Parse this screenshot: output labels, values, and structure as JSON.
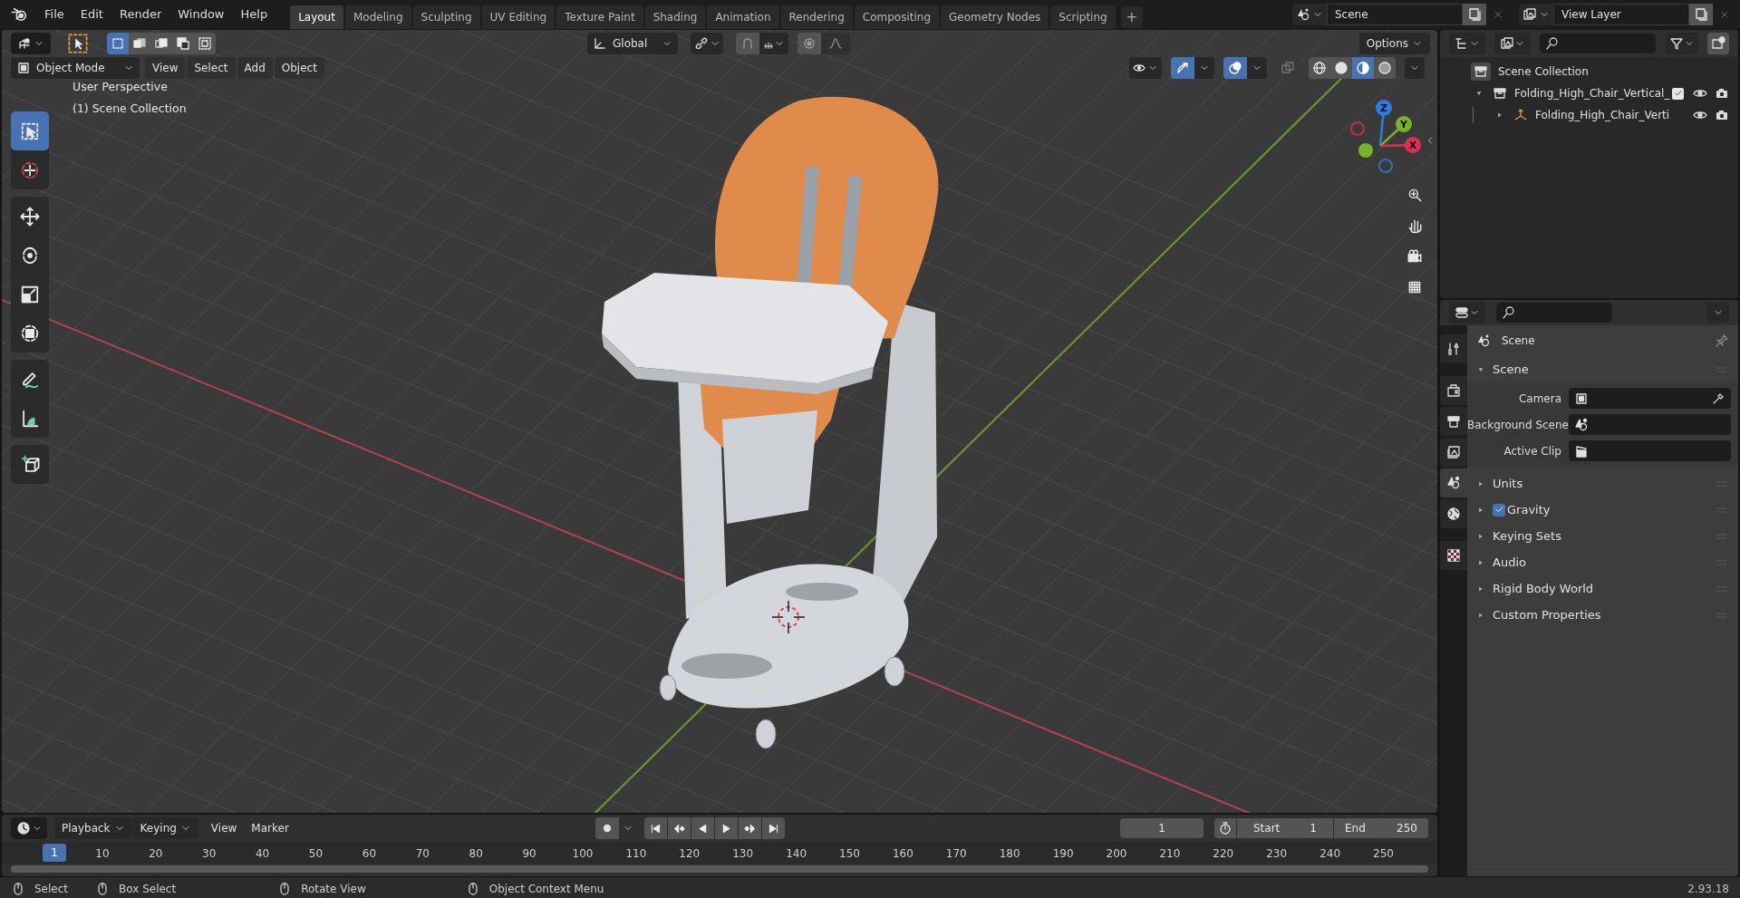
{
  "top_bar": {
    "menus": [
      "File",
      "Edit",
      "Render",
      "Window",
      "Help"
    ],
    "workspace_tabs": [
      {
        "label": "Layout",
        "selected": true
      },
      {
        "label": "Modeling",
        "selected": false
      },
      {
        "label": "Sculpting",
        "selected": false
      },
      {
        "label": "UV Editing",
        "selected": false
      },
      {
        "label": "Texture Paint",
        "selected": false
      },
      {
        "label": "Shading",
        "selected": false
      },
      {
        "label": "Animation",
        "selected": false
      },
      {
        "label": "Rendering",
        "selected": false
      },
      {
        "label": "Compositing",
        "selected": false
      },
      {
        "label": "Geometry Nodes",
        "selected": false
      },
      {
        "label": "Scripting",
        "selected": false
      }
    ],
    "add_tab": "+",
    "scene": "Scene",
    "view_layer": "View Layer"
  },
  "viewport": {
    "select_modes": [
      {
        "selected": true
      },
      {
        "selected": false
      },
      {
        "selected": false
      },
      {
        "selected": false
      },
      {
        "selected": false
      }
    ],
    "orientation": "Global",
    "options": "Options",
    "mode": "Object Mode",
    "menus": [
      "View",
      "Select",
      "Add",
      "Object"
    ],
    "toggles": [
      {
        "kind": "gizmos",
        "on": true
      },
      {
        "kind": "overlays",
        "on": true
      },
      {
        "kind": "xray",
        "on": false
      }
    ],
    "shading_modes": [
      {
        "selected": false
      },
      {
        "selected": false
      },
      {
        "selected": true
      },
      {
        "selected": false
      }
    ],
    "overlay_lines": [
      "User Perspective",
      "(1) Scene Collection"
    ],
    "tools": [
      {
        "selected": true
      },
      {
        "selected": false
      },
      {
        "selected": false
      },
      {
        "selected": false
      },
      {
        "selected": false
      },
      {
        "selected": false
      },
      {
        "selected": false
      },
      {
        "selected": false
      },
      {
        "selected": false
      }
    ],
    "gizmo_axes": [
      "Z",
      "Y",
      "X"
    ]
  },
  "outliner": {
    "root": "Scene Collection",
    "items": [
      {
        "label": "Folding_High_Chair_Vertical_",
        "expanded": true,
        "checked": true,
        "children": [
          {
            "label": "Folding_High_Chair_Verti",
            "expanded": false
          }
        ]
      }
    ]
  },
  "properties": {
    "tabs": [
      {
        "selected": false
      },
      {
        "selected": false
      },
      {
        "selected": false
      },
      {
        "selected": false
      },
      {
        "selected": true
      },
      {
        "selected": false
      },
      {
        "selected": false
      }
    ],
    "context": "Scene",
    "panels": [
      {
        "label": "Scene",
        "expanded": true,
        "fields": [
          {
            "kind": "camera",
            "label": "Camera"
          },
          {
            "kind": "scene",
            "label": "Background Scene"
          },
          {
            "kind": "clip",
            "label": "Active Clip"
          }
        ]
      },
      {
        "label": "Units",
        "expanded": false
      },
      {
        "label": "Gravity",
        "expanded": false,
        "checked": true
      },
      {
        "label": "Keying Sets",
        "expanded": false
      },
      {
        "label": "Audio",
        "expanded": false
      },
      {
        "label": "Rigid Body World",
        "expanded": false
      },
      {
        "label": "Custom Properties",
        "expanded": false
      }
    ]
  },
  "timeline": {
    "menus": [
      "Playback",
      "Keying",
      "View",
      "Marker"
    ],
    "current_frame": "1",
    "start_label": "Start",
    "start": "1",
    "end_label": "End",
    "end": "250",
    "playhead": "1",
    "ruler": [
      "10",
      "20",
      "30",
      "40",
      "50",
      "60",
      "70",
      "80",
      "90",
      "100",
      "110",
      "120",
      "130",
      "140",
      "150",
      "160",
      "170",
      "180",
      "190",
      "200",
      "210",
      "220",
      "230",
      "240",
      "250"
    ]
  },
  "status_bar": {
    "hints": [
      "Select",
      "Box Select",
      "Rotate View",
      "Object Context Menu"
    ],
    "version": "2.93.18"
  }
}
